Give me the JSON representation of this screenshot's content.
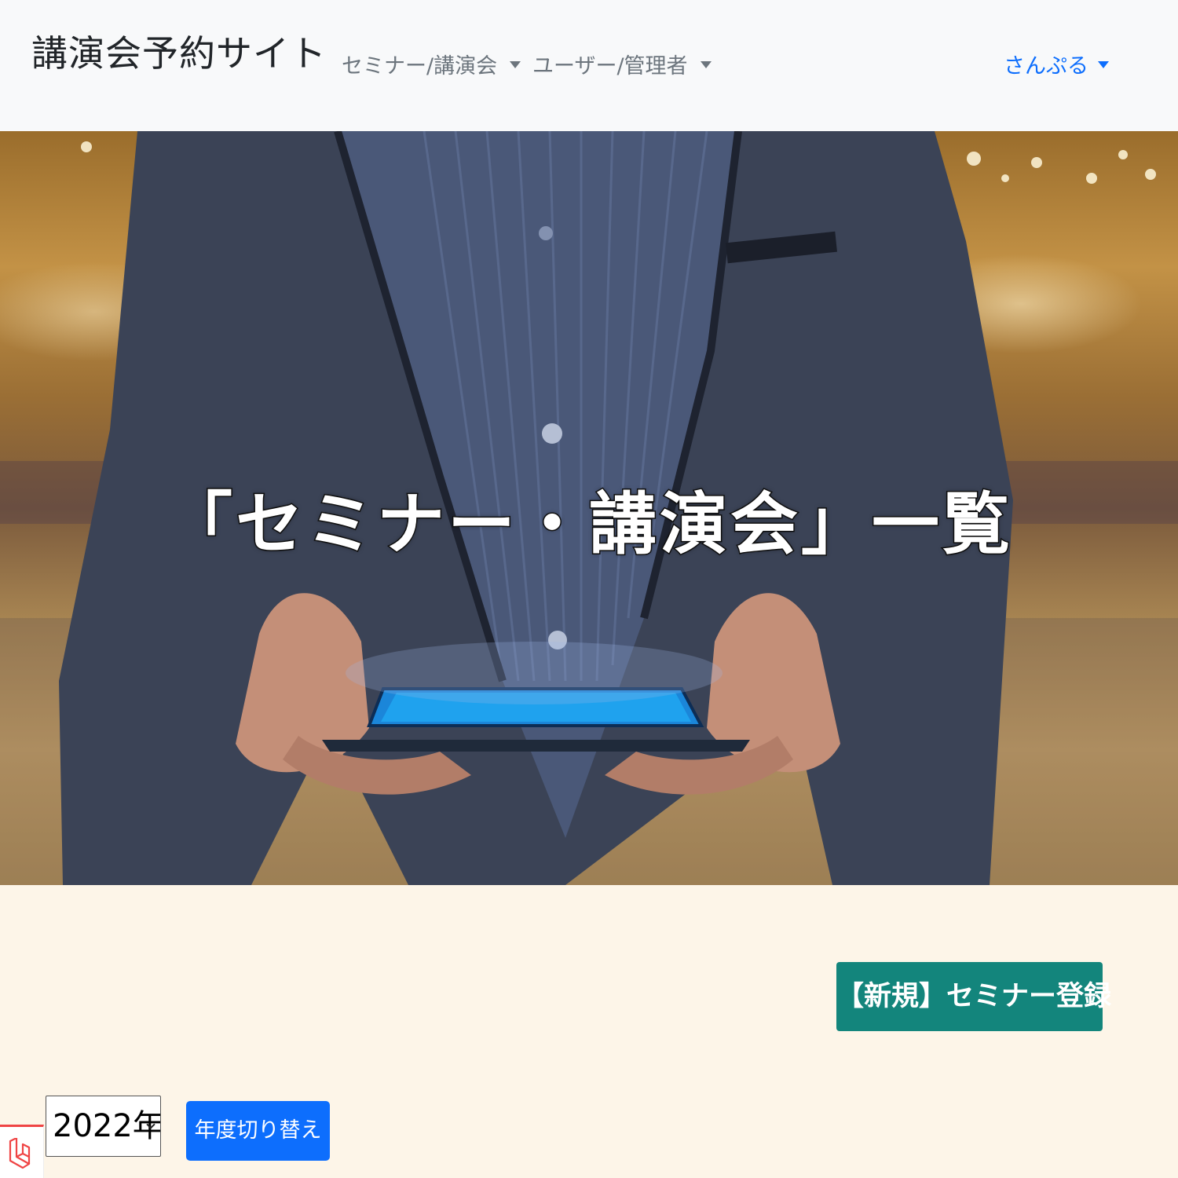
{
  "navbar": {
    "brand": "講演会予約サイト",
    "menu_seminar": "セミナー/講演会",
    "menu_user_admin": "ユーザー/管理者",
    "user_name": "さんぷる"
  },
  "hero": {
    "title": "「セミナー・講演会」一覧"
  },
  "actions": {
    "new_seminar_button": "【新規】セミナー登録",
    "year_select_value": "2022年",
    "year_switch_button": "年度切り替え"
  },
  "colors": {
    "navbar_bg": "#f8f9fa",
    "page_bg": "#fdf5e8",
    "new_button": "#13857c",
    "switch_button": "#0d6efd",
    "user_link": "#0d6efd"
  },
  "icons": {
    "nav_caret": "caret-down-icon",
    "select_chevron": "chevron-down-icon",
    "debug_badge": "laravel-logo-icon"
  }
}
